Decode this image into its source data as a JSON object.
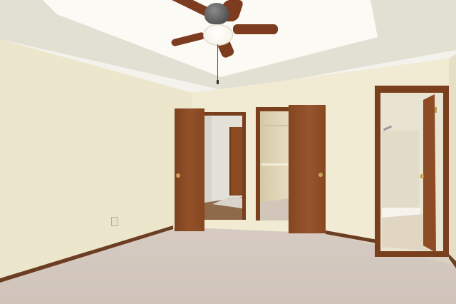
{
  "scene": {
    "colors": {
      "ceiling": "#f3f2ec",
      "ceiling_tray": "#fbfaf5",
      "tray_edge": "#e2dfd3",
      "wall_left": "#ece7cc",
      "wall_back": "#f0ebd2",
      "wall_right": "#efead1",
      "carpet": "#d8cdc4",
      "baseboard": "#6b3d22",
      "door_wood": "#8a4a22",
      "door_frame": "#7a3f1d",
      "closet_interior": "#e6dcc0",
      "hall_wall": "#e4e1d8",
      "hall_floor": "#8f6a4a",
      "bath_wall": "#e9e3d2",
      "bath_floor": "#e1d6c2",
      "fan_blade": "#7d3c1f",
      "fan_light": "#fbf8ec",
      "outlet": "#e8e2c8"
    }
  }
}
